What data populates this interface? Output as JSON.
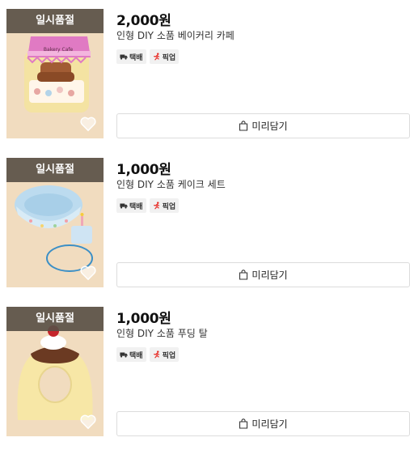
{
  "items": [
    {
      "price": "2,000원",
      "name": "인형 DIY 소품 베이커리 카페",
      "soldout": "일시품절",
      "badge_delivery": "택배",
      "badge_pickup": "픽업",
      "cart": "미리담기",
      "icon": "bakery-cafe-box"
    },
    {
      "price": "1,000원",
      "name": "인형 DIY 소품 케이크 세트",
      "soldout": "일시품절",
      "badge_delivery": "택배",
      "badge_pickup": "픽업",
      "cart": "미리담기",
      "icon": "cake-hat"
    },
    {
      "price": "1,000원",
      "name": "인형 DIY 소품 푸딩 탈",
      "soldout": "일시품절",
      "badge_delivery": "택배",
      "badge_pickup": "픽업",
      "cart": "미리담기",
      "icon": "pudding-mask"
    }
  ],
  "colors": {
    "soldout_bg": "#5a5046",
    "thumb_bg": "#f2dcc0",
    "pickup_icon": "#e8302a"
  }
}
